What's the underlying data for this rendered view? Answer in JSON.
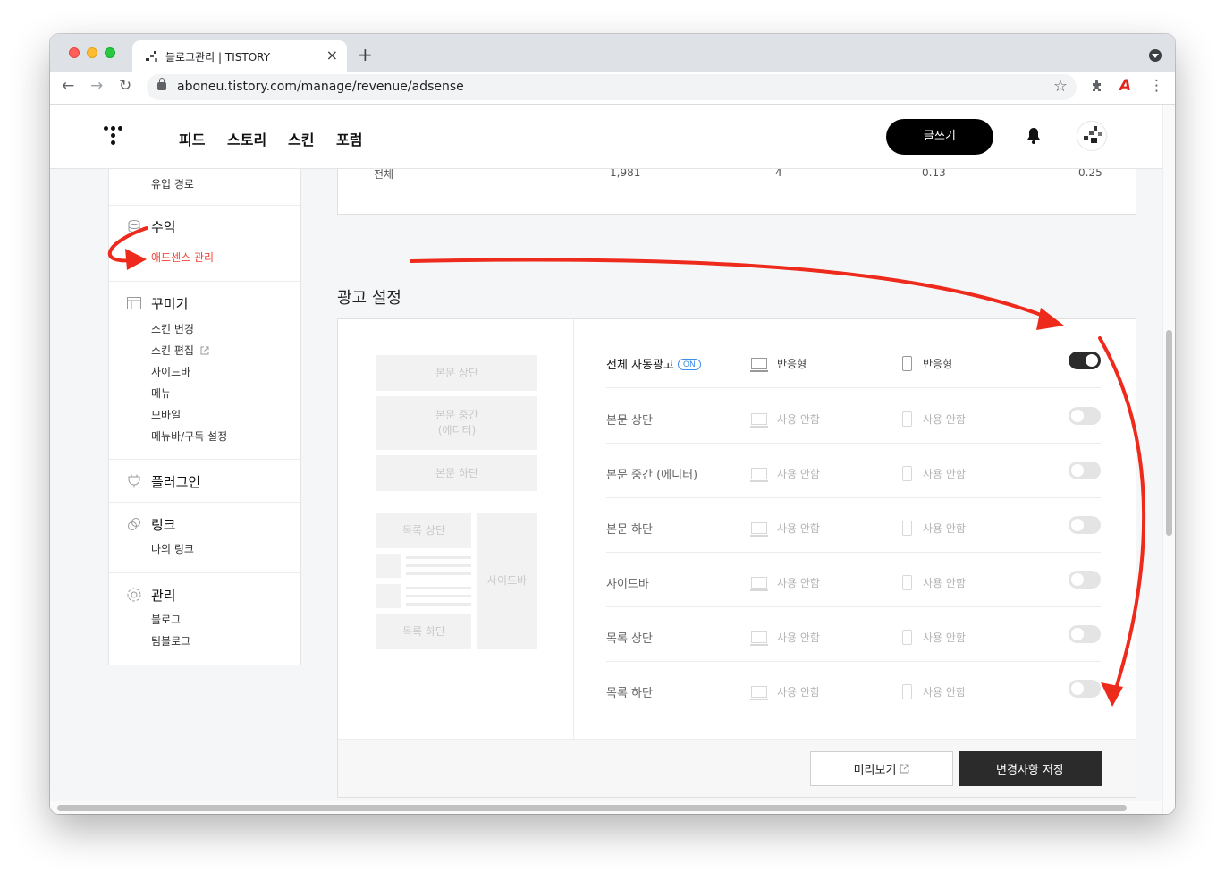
{
  "browser": {
    "tab_title": "블로그관리 | TISTORY",
    "tab_close": "×",
    "new_tab": "+",
    "url": "aboneu.tistory.com/manage/revenue/adsense",
    "back": "←",
    "forward": "→",
    "reload": "↻",
    "bookmark": "☆",
    "more": "⋮",
    "extension_badge": "A"
  },
  "header": {
    "nav": [
      "피드",
      "스토리",
      "스킨",
      "포럼"
    ],
    "write_button": "글쓰기"
  },
  "sidebar": {
    "stats_item": "유입 경로",
    "revenue": {
      "title": "수익",
      "items": [
        "애드센스 관리"
      ]
    },
    "decorate": {
      "title": "꾸미기",
      "items": [
        "스킨 변경",
        "스킨 편집",
        "사이드바",
        "메뉴",
        "모바일",
        "메뉴바/구독 설정"
      ]
    },
    "plugin": {
      "title": "플러그인"
    },
    "link": {
      "title": "링크",
      "items": [
        "나의 링크"
      ]
    },
    "manage": {
      "title": "관리",
      "items": [
        "블로그",
        "팀블로그"
      ]
    },
    "active_color": "#f44336"
  },
  "stats_summary": {
    "label": "전체",
    "values": [
      "1,981",
      "4",
      "0.13",
      "0.25"
    ]
  },
  "ad_settings": {
    "title": "광고 설정",
    "diagram": {
      "body_top": "본문 상단",
      "body_middle": "본문 중간\n(에디터)",
      "body_bottom": "본문 하단",
      "list_top": "목록 상단",
      "list_bottom": "목록 하단",
      "sidebar": "사이드바"
    },
    "rows": [
      {
        "label": "전체 자동광고",
        "badge": "ON",
        "pc": "반응형",
        "mobile": "반응형",
        "enabled": true
      },
      {
        "label": "본문 상단",
        "pc": "사용 안함",
        "mobile": "사용 안함",
        "enabled": false
      },
      {
        "label": "본문 중간 (에디터)",
        "pc": "사용 안함",
        "mobile": "사용 안함",
        "enabled": false
      },
      {
        "label": "본문 하단",
        "pc": "사용 안함",
        "mobile": "사용 안함",
        "enabled": false
      },
      {
        "label": "사이드바",
        "pc": "사용 안함",
        "mobile": "사용 안함",
        "enabled": false
      },
      {
        "label": "목록 상단",
        "pc": "사용 안함",
        "mobile": "사용 안함",
        "enabled": false
      },
      {
        "label": "목록 하단",
        "pc": "사용 안함",
        "mobile": "사용 안함",
        "enabled": false
      }
    ],
    "preview_button": "미리보기",
    "save_button": "변경사항 저장"
  },
  "colors": {
    "annotation_arrow": "#ee2a1c",
    "toggle_on": "#2b2b2b",
    "toggle_off": "#e4e4e4",
    "badge_blue": "#3c8eea"
  }
}
